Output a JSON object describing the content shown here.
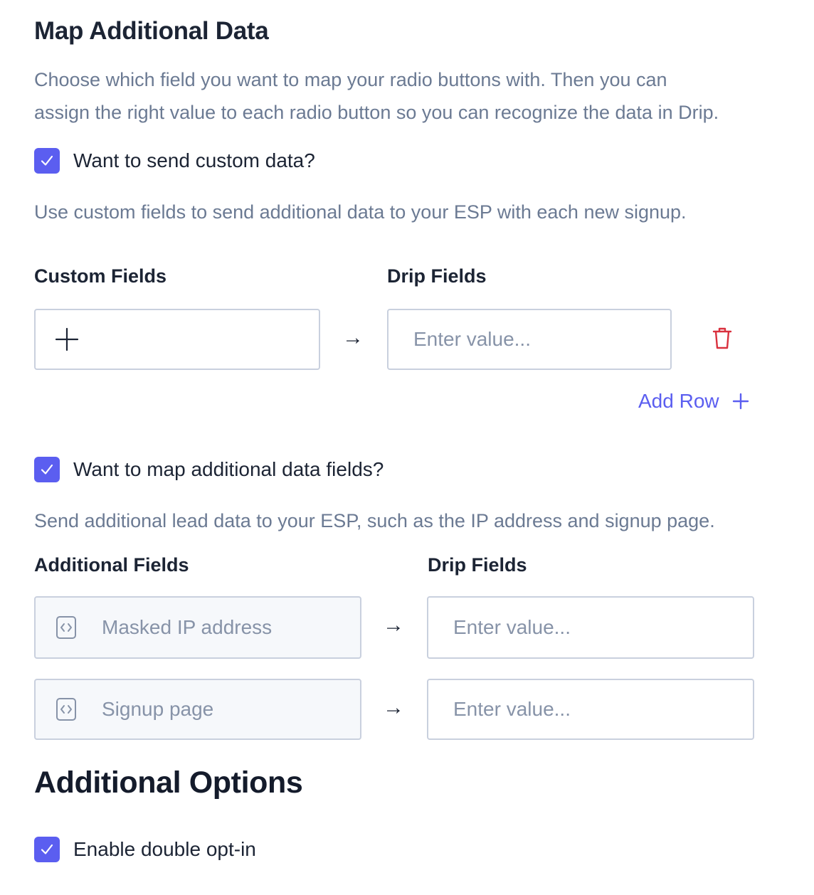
{
  "map_section": {
    "title": "Map Additional Data",
    "description_line1": "Choose which field you want to map your radio buttons with. Then you can",
    "description_line2": "assign the right value to each radio button so you can recognize the data in Drip."
  },
  "custom_data": {
    "checkbox_label": "Want to send custom data?",
    "checked": true,
    "description": "Use custom fields to send additional data to your ESP with each new signup.",
    "col_left_label": "Custom Fields",
    "col_right_label": "Drip Fields",
    "add_icon": "plus-icon",
    "arrow": "→",
    "drip_placeholder": "Enter value...",
    "delete_icon": "trash-icon",
    "add_row_label": "Add Row"
  },
  "additional_fields": {
    "checkbox_label": "Want to map additional data fields?",
    "checked": true,
    "description": "Send additional lead data to your ESP, such as the IP address and signup page.",
    "col_left_label": "Additional Fields",
    "col_right_label": "Drip Fields",
    "arrow": "→",
    "rows": [
      {
        "icon": "code-file-icon",
        "field": "Masked IP address",
        "placeholder": "Enter value..."
      },
      {
        "icon": "code-file-icon",
        "field": "Signup page",
        "placeholder": "Enter value..."
      }
    ]
  },
  "options_section": {
    "title": "Additional Options",
    "double_optin_label": "Enable double opt-in",
    "double_optin_checked": true
  },
  "colors": {
    "accent": "#5b5ef0",
    "danger": "#d9313e",
    "muted_text": "#6b7a93",
    "border": "#c9d0de"
  }
}
